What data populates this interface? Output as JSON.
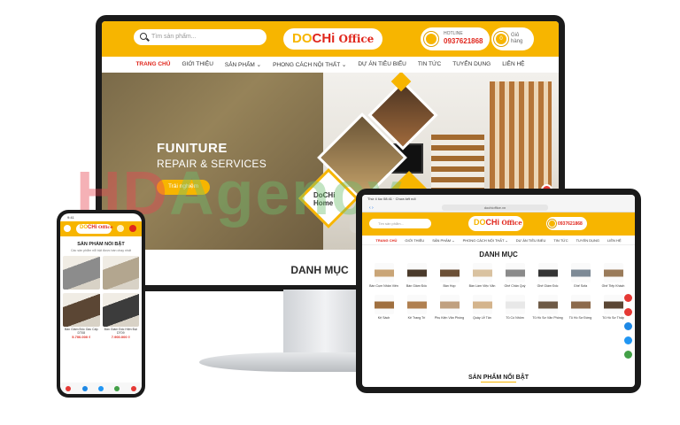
{
  "colors": {
    "brand_yellow": "#f7b500",
    "brand_red": "#e0261c",
    "call_red": "#e53935",
    "zalo_blue": "#1e88e5",
    "messenger": "#2196f3",
    "green": "#43a047"
  },
  "brand": {
    "logo_do": "DO",
    "logo_chi": "CHi",
    "logo_office": "Office",
    "home_line1": "DoCHi",
    "home_line2": "Home"
  },
  "desktop": {
    "search_placeholder": "Tìm sản phẩm...",
    "hotline_label": "HOTLINE",
    "hotline_number": "0937621868",
    "cart_count": "0",
    "cart_label_1": "Giỏ",
    "cart_label_2": "hàng",
    "nav": [
      "TRANG CHỦ",
      "GIỚI THIỆU",
      "SẢN PHẨM ⌄",
      "PHONG CÁCH NỘI THẤT ⌄",
      "DỰ ÁN TIÊU BIỂU",
      "TIN TỨC",
      "TUYỂN DỤNG",
      "LIÊN HỆ"
    ],
    "hero_title": "FUNITURE",
    "hero_subtitle": "REPAIR & SERVICES",
    "hero_button": "Trải nghiệm",
    "section_title": "DANH MỤC"
  },
  "watermark": {
    "part1": "HD",
    "part2": "Agency"
  },
  "tablet": {
    "status": "Thứ 4 lúc 08:41 · Chưa kết nối",
    "tabs_label": "‹   ›",
    "url": "dochioffice.vn",
    "search_placeholder": "Tìm sản phẩm...",
    "hotline_number": "0937621868",
    "nav": [
      "TRANG CHỦ",
      "GIỚI THIỆU",
      "SẢN PHẨM ⌄",
      "PHONG CÁCH NỘI THẤT ⌄",
      "DỰ ÁN TIÊU BIỂU",
      "TIN TỨC",
      "TUYỂN DỤNG",
      "LIÊN HỆ"
    ],
    "section_title": "DANH MỤC",
    "categories": [
      {
        "name": "Bàn Cụm Nhân Viên",
        "color": "#c9a577"
      },
      {
        "name": "Bàn Giám Đốc",
        "color": "#4a3a2b"
      },
      {
        "name": "Bàn Họp",
        "color": "#6b4f35"
      },
      {
        "name": "Bàn Làm Việc Văn",
        "color": "#d9c2a0"
      },
      {
        "name": "Ghế Chân Quỳ",
        "color": "#8a8a8a"
      },
      {
        "name": "Ghế Giám Đốc",
        "color": "#333333"
      },
      {
        "name": "Ghế Sofa",
        "color": "#7d8a96"
      },
      {
        "name": "Ghế Tiếp Khách",
        "color": "#9a7b5a"
      },
      {
        "name": "Kệ Sách",
        "color": "#a07040"
      },
      {
        "name": "Kệ Trang Trí",
        "color": "#b08050"
      },
      {
        "name": "Phụ Kiện Văn Phòng",
        "color": "#c0a080"
      },
      {
        "name": "Quầy Lễ Tân",
        "color": "#d4b48c"
      },
      {
        "name": "Tủ Có Nhôm",
        "color": "#e8e8e8"
      },
      {
        "name": "Tủ Hồ Sơ Văn Phòng",
        "color": "#6e5a46"
      },
      {
        "name": "Tủ Hồ Sơ Đứng",
        "color": "#8c6a4c"
      },
      {
        "name": "Tủ Hồ Sơ Thấp",
        "color": "#5a4634"
      }
    ],
    "bottom_title": "SẢN PHẨM NỔI BẬT"
  },
  "phone": {
    "status": "9:41",
    "section_title": "SẢN PHẨM NỔI BẬT",
    "section_sub": "Các sản phẩm nổi bật được bán chạy nhất",
    "products": [
      {
        "name": "",
        "price": "",
        "color": "#8c8c8c"
      },
      {
        "name": "",
        "price": "",
        "color": "#b3a68f"
      },
      {
        "name": "Bàn Giám Đốc Gác Cấp DT08",
        "price": "5.700.000 ₫",
        "color": "#5b4634"
      },
      {
        "name": "Bàn Giám Đốc Hiện Đại DT09",
        "price": "7.900.000 ₫",
        "color": "#3c3c3c"
      }
    ]
  }
}
